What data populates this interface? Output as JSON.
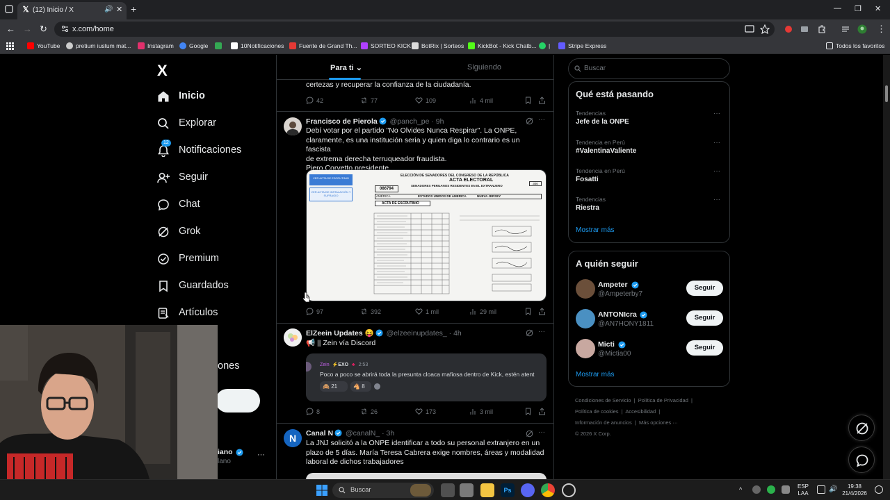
{
  "browser": {
    "tab_title": "(12) Inicio / X",
    "url": "x.com/home",
    "bookmarks": [
      {
        "label": "YouTube",
        "color": "#ff0000"
      },
      {
        "label": "pretium iustum mat...",
        "color": "#cccccc"
      },
      {
        "label": "Instagram",
        "color": "#e1306c"
      },
      {
        "label": "Google",
        "color": "#4285f4"
      },
      {
        "label": "",
        "color": "#34a853"
      },
      {
        "label": "10Notificaciones",
        "color": "#ffffff"
      },
      {
        "label": "Fuente de Grand Th...",
        "color": "#e53935"
      },
      {
        "label": "SORTEO KICK",
        "color": "#b040ff"
      },
      {
        "label": "BotRix | Sorteos",
        "color": "#dddddd"
      },
      {
        "label": "KickBot - Kick Chatb...",
        "color": "#53fc18"
      },
      {
        "label": "|",
        "color": "#25d366"
      },
      {
        "label": "Stripe Express",
        "color": "#635bff"
      }
    ],
    "other_bookmarks": "Todos los favoritos"
  },
  "sidebar": {
    "logo": "X",
    "items": [
      {
        "label": "Inicio",
        "icon": "home-icon"
      },
      {
        "label": "Explorar",
        "icon": "search-icon"
      },
      {
        "label": "Notificaciones",
        "icon": "bell-icon",
        "badge": "12"
      },
      {
        "label": "Seguir",
        "icon": "follow-icon"
      },
      {
        "label": "Chat",
        "icon": "chat-icon"
      },
      {
        "label": "Grok",
        "icon": "grok-icon"
      },
      {
        "label": "Premium",
        "icon": "premium-icon"
      },
      {
        "label": "Guardados",
        "icon": "bookmark-icon"
      },
      {
        "label": "Artículos",
        "icon": "articles-icon"
      }
    ],
    "partial_item": "ones",
    "post_button_partial": "r",
    "profile_name_partial": "iano",
    "profile_handle_partial": "lano"
  },
  "feed": {
    "tabs": [
      {
        "label": "Para ti"
      },
      {
        "label": "Siguiendo"
      }
    ],
    "partial_top": {
      "text": "certezas y recuperar la confianza de la ciudadanía.",
      "replies": "42",
      "reposts": "77",
      "likes": "109",
      "views": "4 mil"
    },
    "tweets": [
      {
        "name": "Francisco de Pierola",
        "handle": "@panch_pe",
        "time": "· 9h",
        "lines": [
          "Debí votar por el partido \"No Olvides Nunca Respirar\". La ONPE,",
          "claramente, es una institución seria y quien diga lo contrario es un fascista",
          "de extrema derecha terruqueador fraudista.",
          "Piero Corvetto presidente."
        ],
        "image": {
          "title1": "ELECCIÓN DE SENADORES DEL CONGRESO DE LA REPÚBLICA",
          "title2": "ACTA ELECTORAL",
          "title3": "SENADORES PERUANOS RESIDENTES EN EL EXTRANJERO",
          "code": "086794",
          "region": "AMÉRICA",
          "country": "ESTADOS UNIDOS DE AMERICA",
          "city": "NUEVA JERSEY",
          "section": "ACTA DE ESCRUTINIO",
          "btn1": "VER ACTA DE ESCRUTINIO",
          "btn2": "VER ACTA DE INSTALACIÓN Y SUFRAGIO",
          "num": "300"
        },
        "replies": "97",
        "reposts": "392",
        "likes": "1 mil",
        "views": "29 mil"
      },
      {
        "name": "ElZeein Updates 😝",
        "handle": "@elzeeinupdates_",
        "time": "· 4h",
        "lines": [
          "📢 || Zein vía Discord"
        ],
        "quote": {
          "user": "Zein",
          "tag": "EXO",
          "time": "2:53",
          "text": "Poco a poco se abrirá toda la presunta cloaca mafiosa dentro de Kick, estén atent",
          "r1": "21",
          "r2": "8"
        },
        "replies": "8",
        "reposts": "26",
        "likes": "173",
        "views": "3 mil"
      },
      {
        "name": "Canal N",
        "handle": "@canalN_",
        "time": "· 3h",
        "lines": [
          "La JNJ solicitó a la ONPE identificar a todo su personal extranjero en un",
          "plazo de 5 días. María Teresa Cabrera exige nombres, áreas y modalidad",
          "laboral de dichos trabajadores"
        ]
      }
    ]
  },
  "right": {
    "search_placeholder": "Buscar",
    "trending_title": "Qué está pasando",
    "trends": [
      {
        "meta": "Tendencias",
        "name": "Jefe de la ONPE"
      },
      {
        "meta": "Tendencia en Perú",
        "name": "#ValentinaValiente"
      },
      {
        "meta": "Tendencia en Perú",
        "name": "Fosatti"
      },
      {
        "meta": "Tendencias",
        "name": "Riestra"
      }
    ],
    "show_more": "Mostrar más",
    "who_title": "A quién seguir",
    "who": [
      {
        "name": "Ampeter",
        "handle": "@Ampeterby7",
        "color": "#6b4f3a"
      },
      {
        "name": "ANTONIcra",
        "handle": "@AN7HONY1811",
        "color": "#4a90c2"
      },
      {
        "name": "Micti",
        "handle": "@Mictia00",
        "color": "#c8a8a0"
      }
    ],
    "follow_label": "Seguir",
    "footer": [
      "Condiciones de Servicio",
      "Política de Privacidad",
      "Política de cookies",
      "Accesibilidad",
      "Información de anuncios",
      "Más opciones ···",
      "© 2026 X Corp."
    ]
  },
  "taskbar": {
    "search": "Buscar",
    "lang1": "ESP",
    "lang2": "LAA",
    "time": "19:38",
    "date": "21/4/2026"
  }
}
